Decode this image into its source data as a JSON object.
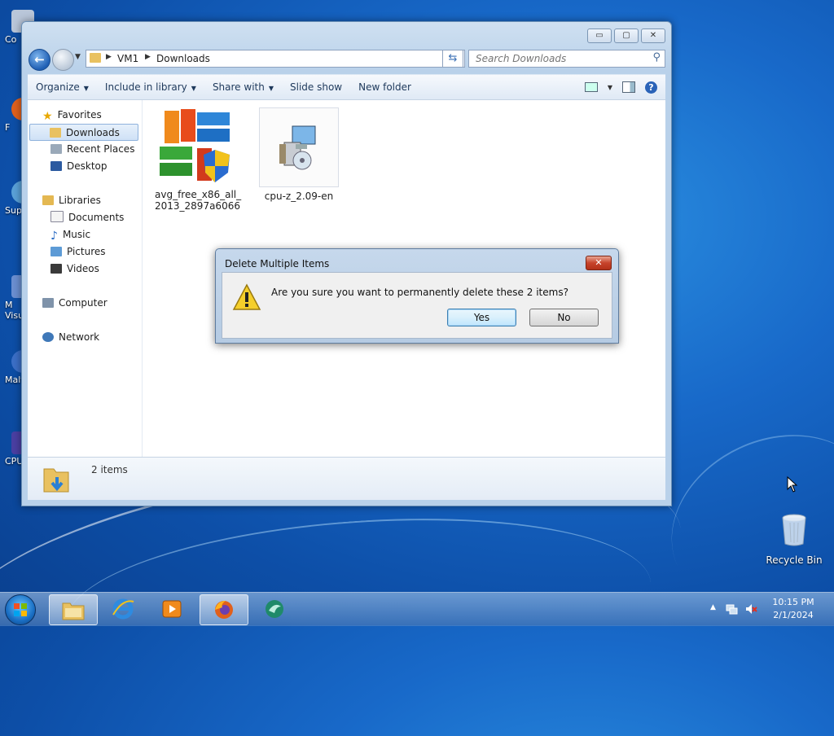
{
  "desktop": {
    "left_icons": [
      {
        "label": "Co",
        "color": "#b9c6d9"
      },
      {
        "label": "F",
        "color": "#e0601c"
      },
      {
        "label": "Sup",
        "color": "#5aa1d8"
      },
      {
        "label": "M\nVisu",
        "color": "#6b8fd1"
      },
      {
        "label": "Malv",
        "color": "#3b6fc7"
      },
      {
        "label": "CPU",
        "color": "#4a3fa2"
      }
    ],
    "recycle_bin_label": "Recycle Bin"
  },
  "explorer": {
    "window_controls": {
      "minimize": "▭",
      "maximize": "▢",
      "close": "✕"
    },
    "breadcrumbs": [
      "VM1",
      "Downloads"
    ],
    "search_placeholder": "Search Downloads",
    "toolbar": {
      "organize": "Organize",
      "include_in_library": "Include in library",
      "share_with": "Share with",
      "slide_show": "Slide show",
      "new_folder": "New folder",
      "help": "?"
    },
    "nav": {
      "favorites": "Favorites",
      "downloads": "Downloads",
      "recent_places": "Recent Places",
      "desktop": "Desktop",
      "libraries": "Libraries",
      "documents": "Documents",
      "music": "Music",
      "pictures": "Pictures",
      "videos": "Videos",
      "computer": "Computer",
      "network": "Network"
    },
    "files": [
      {
        "name": "avg_free_x86_all_\n2013_2897a6066",
        "icon": "avg-installer-icon"
      },
      {
        "name": "cpu-z_2.09-en",
        "icon": "setup-installer-icon"
      }
    ],
    "details_count": "2 items"
  },
  "dialog": {
    "title": "Delete Multiple Items",
    "message": "Are you sure you want to permanently delete these 2 items?",
    "yes_label": "Yes",
    "no_label": "No",
    "close": "✕"
  },
  "taskbar": {
    "time": "10:15 PM",
    "date": "2/1/2024",
    "tray_arrow": "▲"
  }
}
